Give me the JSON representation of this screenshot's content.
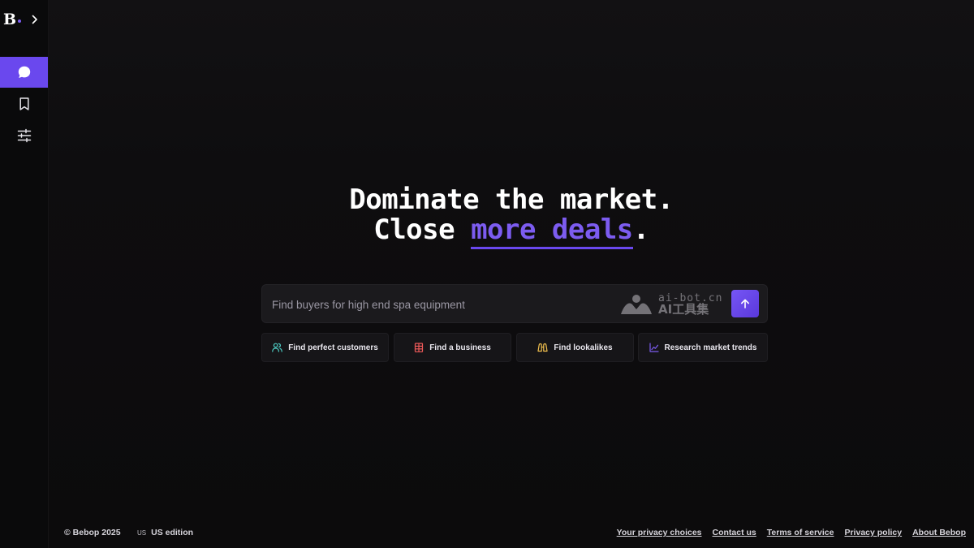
{
  "brand": {
    "logo_letter": "B"
  },
  "sidebar": {
    "items": [
      {
        "name": "chat",
        "icon": "chat-bubble-icon",
        "active": true
      },
      {
        "name": "saved",
        "icon": "bookmark-icon",
        "active": false
      },
      {
        "name": "filters",
        "icon": "sliders-icon",
        "active": false
      }
    ]
  },
  "hero": {
    "line1": "Dominate the market.",
    "line2_prefix": "Close ",
    "line2_accent": "more deals",
    "line2_suffix": "."
  },
  "search": {
    "placeholder": "Find buyers for high end spa equipment",
    "submit_icon": "arrow-up-icon"
  },
  "watermark": {
    "line1": "ai-bot.cn",
    "line2": "AI工具集"
  },
  "chips": [
    {
      "label": "Find perfect customers",
      "icon": "users-icon",
      "color": "#4ecdc4"
    },
    {
      "label": "Find a business",
      "icon": "building-icon",
      "color": "#ef5a5a"
    },
    {
      "label": "Find lookalikes",
      "icon": "binoculars-icon",
      "color": "#f2c14e"
    },
    {
      "label": "Research market trends",
      "icon": "line-chart-icon",
      "color": "#7c5cf0"
    }
  ],
  "footer": {
    "copyright": "© Bebop 2025",
    "edition_flag": "US",
    "edition": "US edition",
    "links": [
      "Your privacy choices",
      "Contact us",
      "Terms of service",
      "Privacy policy",
      "About Bebop"
    ]
  },
  "colors": {
    "accent": "#6a48ee",
    "accent_text": "#7c5cf0",
    "background": "#0c0b0c"
  }
}
